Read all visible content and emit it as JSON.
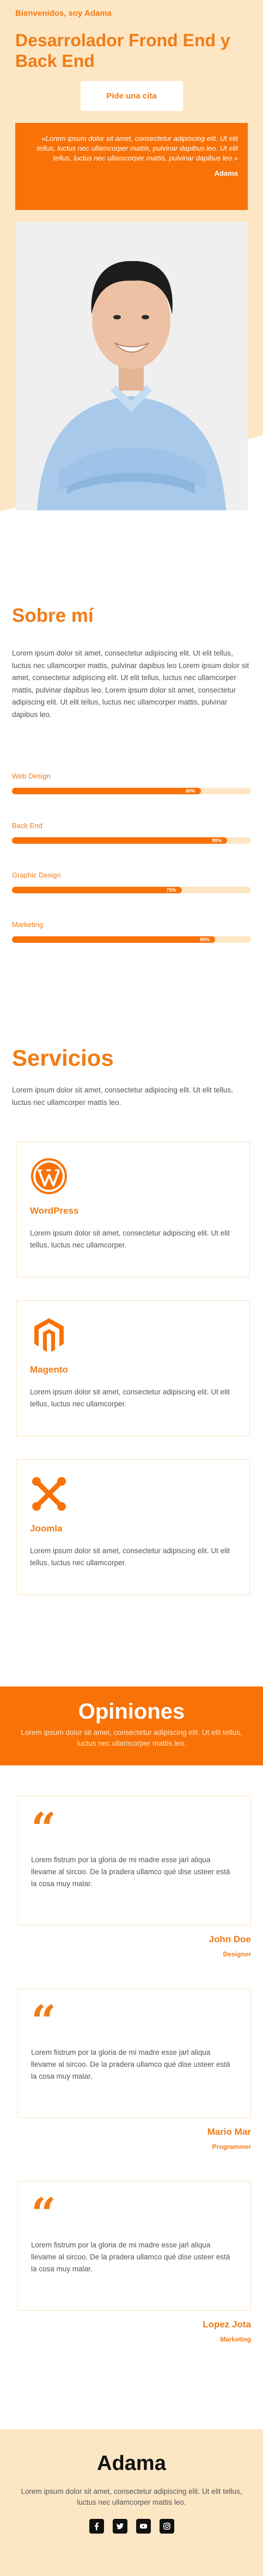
{
  "hero": {
    "greeting": "Bienvenidos, soy Adama",
    "title": "Desarrolador Frond End y Back End",
    "cta_label": "Pide una cita",
    "quote_text": "«Lorem ipsum dolor sit amet, consectetur adipiscing elit. Ut elit tellus, luctus nec ullamcorper mattis, pulvinar dapibus leo. Ut elit tellus, luctus nec ullamcorper mattis, pulvinar dapibus leo.»",
    "quote_author": "Adama"
  },
  "about": {
    "title": "Sobre mí",
    "text": "Lorem ipsum dolor sit amet, consectetur adipiscing elit. Ut elit tellus, luctus nec ullamcorper mattis, pulvinar dapibus leo Lorem ipsum dolor sit amet, consectetur adipiscing elit. Ut elit tellus, luctus nec ullamcorper mattis, pulvinar dapibus leo. Lorem ipsum dolor sit amet, consectetur adipiscing elit. Ut elit tellus, luctus nec ullamcorper mattis, pulvinar dapibus leo.",
    "skills": [
      {
        "label": "Web Design",
        "value": 0.79,
        "value_label": "80%"
      },
      {
        "label": "Back End",
        "value": 0.9,
        "value_label": "90%"
      },
      {
        "label": "Graphic Design",
        "value": 0.71,
        "value_label": "75%"
      },
      {
        "label": "Marketing",
        "value": 0.85,
        "value_label": "85%"
      }
    ]
  },
  "services": {
    "title": "Servicios",
    "lead": "Lorem ipsum dolor sit amet, consectetur adipiscing elit. Ut elit tellus, luctus nec ullamcorper mattis leo.",
    "items": [
      {
        "title": "WordPress",
        "desc": "Lorem ipsum dolor sit amet, consectetur adipiscing elit. Ut elit tellus, luctus nec ullamcorper.",
        "icon": "wordpress-icon"
      },
      {
        "title": "Magento",
        "desc": "Lorem ipsum dolor sit amet, consectetur adipiscing elit. Ut elit tellus, luctus nec ullamcorper.",
        "icon": "magento-icon"
      },
      {
        "title": "Joomla",
        "desc": "Lorem ipsum dolor sit amet, consectetur adipiscing elit. Ut elit tellus, luctus nec ullamcorper.",
        "icon": "joomla-icon"
      }
    ]
  },
  "opinions": {
    "title": "Opiniones",
    "lead": "Lorem ipsum dolor sit amet, consectetur adipiscing elit. Ut elit tellus, luctus nec ullamcorper mattis leo.",
    "items": [
      {
        "text": "Lorem fistrum por la gloria de mi madre esse jarl aliqua llevame al sircoo. De la pradera ullamco qué dise usteer está la cosa muy malar.",
        "name": "John Doe",
        "role": "Designer"
      },
      {
        "text": "Lorem fistrum por la gloria de mi madre esse jarl aliqua llevame al sircoo. De la pradera ullamco qué dise usteer está la cosa muy malar.",
        "name": "Mario Mar",
        "role": "Programmer"
      },
      {
        "text": "Lorem fistrum por la gloria de mi madre esse jarl aliqua llevame al sircoo. De la pradera ullamco qué dise usteer está la cosa muy malar.",
        "name": "Lopez Jota",
        "role": "Marketing"
      }
    ]
  },
  "footer": {
    "title": "Adama",
    "text": "Lorem ipsum dolor sit amet, consectetur adipiscing elit. Ut elit tellus, luctus nec ullamcorper mattis leo.",
    "socials": [
      "facebook-icon",
      "twitter-icon",
      "youtube-icon",
      "instagram-icon"
    ]
  },
  "colors": {
    "accent": "#f97208",
    "accent_text": "#f07c17",
    "cream": "#fde6c4"
  }
}
